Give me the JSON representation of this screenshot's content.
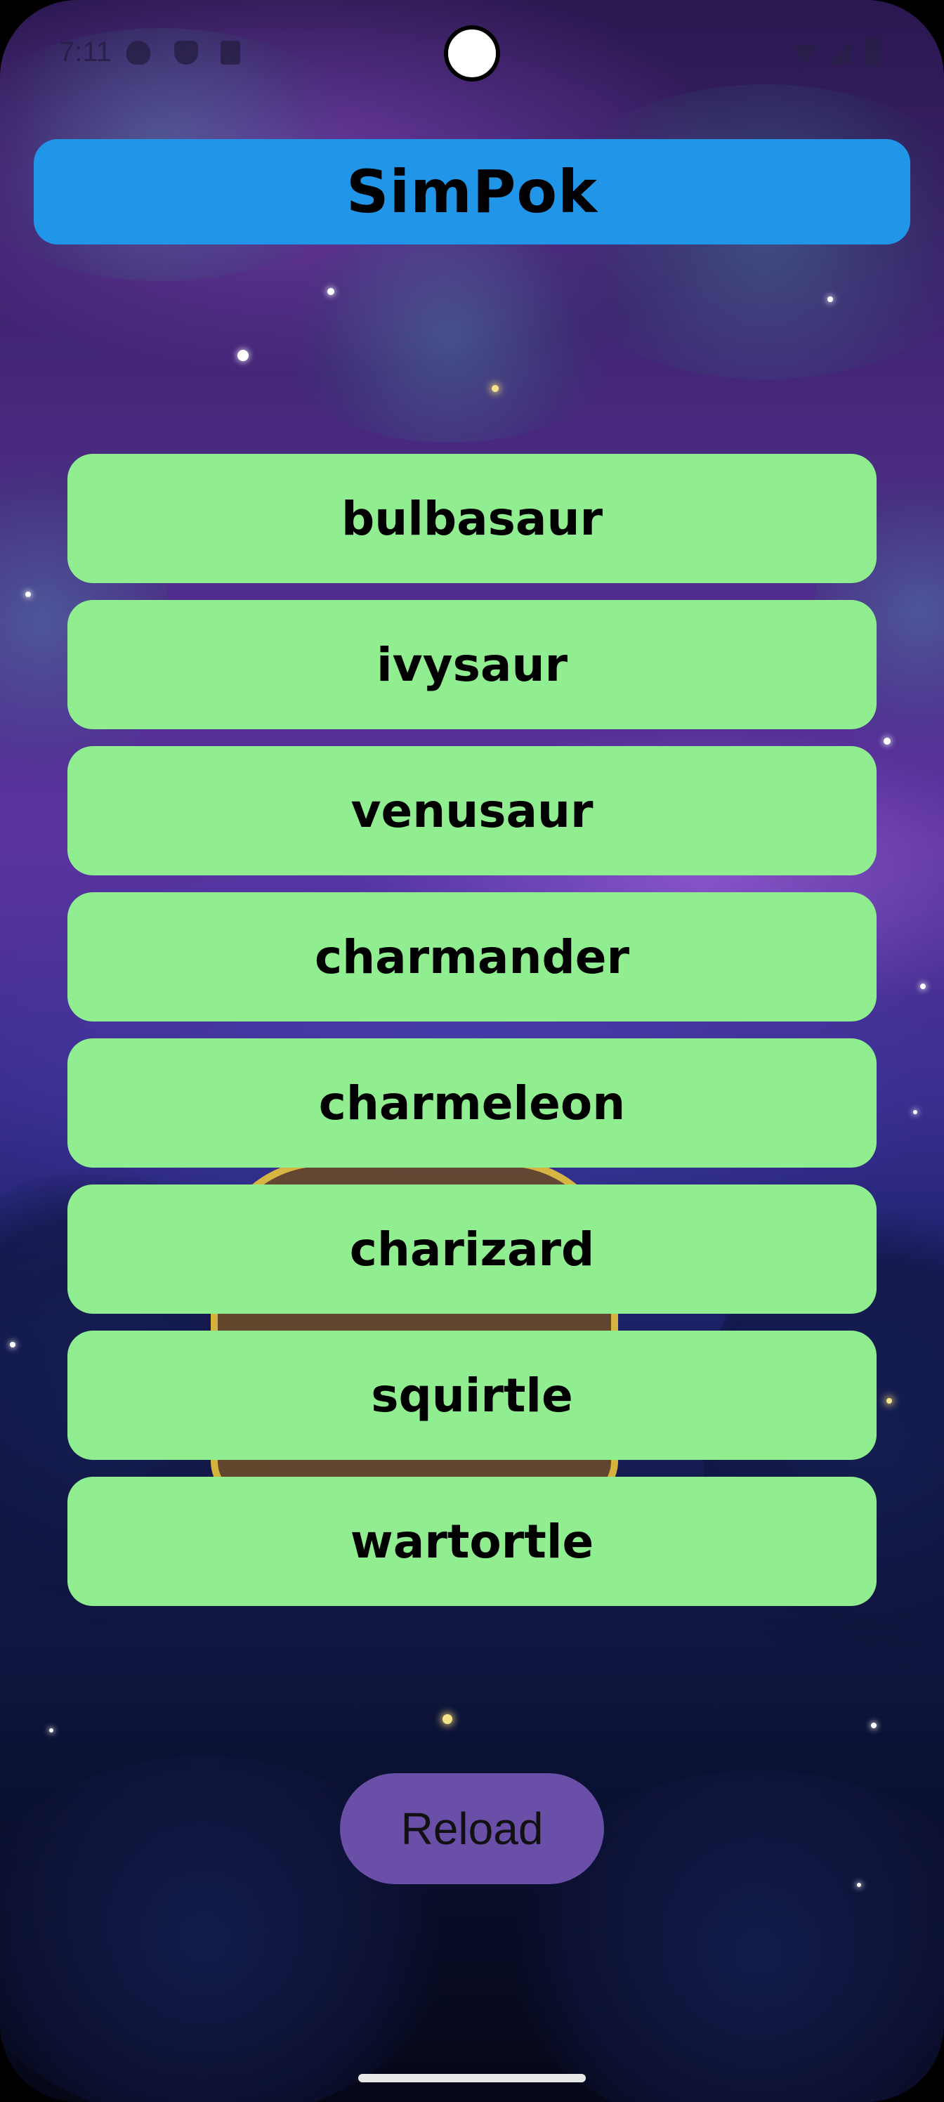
{
  "status_bar": {
    "time": "7:11",
    "icons": [
      "shield-icon",
      "vpn-icon",
      "sd-card-icon",
      "wifi-icon",
      "signal-icon",
      "battery-icon"
    ]
  },
  "app": {
    "title": "SimPok"
  },
  "pokemon_list": {
    "items": [
      {
        "name": "bulbasaur"
      },
      {
        "name": "ivysaur"
      },
      {
        "name": "venusaur"
      },
      {
        "name": "charmander"
      },
      {
        "name": "charmeleon"
      },
      {
        "name": "charizard"
      },
      {
        "name": "squirtle"
      },
      {
        "name": "wartortle"
      }
    ]
  },
  "actions": {
    "reload_label": "Reload"
  },
  "colors": {
    "title_bar": "#2196e8",
    "list_item": "#90ee90",
    "reload_button": "#6a4fa8"
  }
}
